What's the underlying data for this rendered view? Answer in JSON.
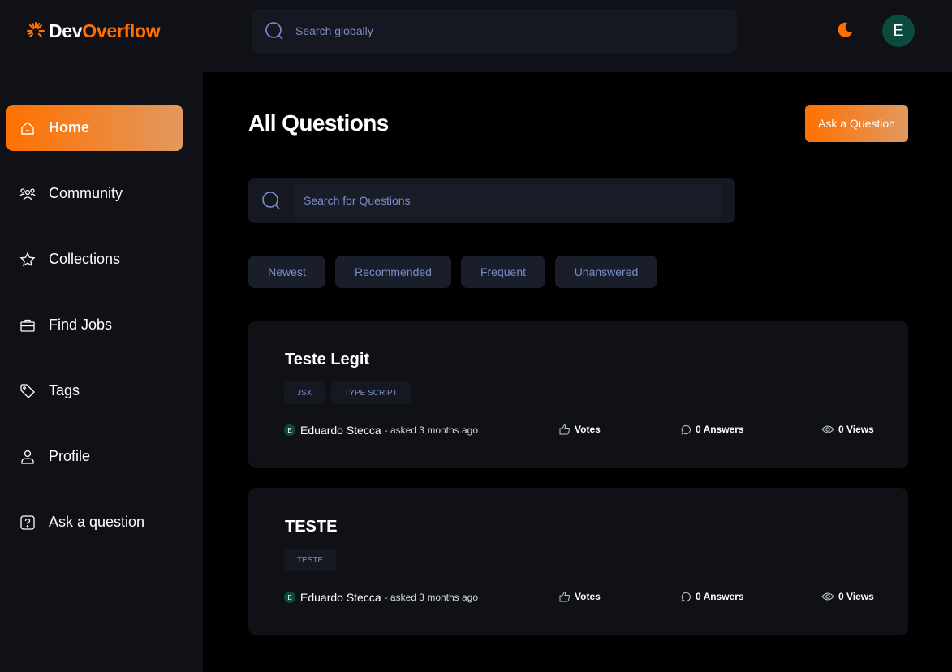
{
  "navbar": {
    "logo_prefix": "Dev",
    "logo_suffix": "Overflow",
    "search_placeholder": "Search globally",
    "avatar_initial": "E"
  },
  "sidebar": {
    "items": [
      {
        "label": "Home",
        "icon": "home-icon",
        "active": true
      },
      {
        "label": "Community",
        "icon": "users-icon"
      },
      {
        "label": "Collections",
        "icon": "star-icon"
      },
      {
        "label": "Find Jobs",
        "icon": "briefcase-icon"
      },
      {
        "label": "Tags",
        "icon": "tag-icon"
      },
      {
        "label": "Profile",
        "icon": "user-icon"
      },
      {
        "label": "Ask a question",
        "icon": "question-icon"
      }
    ]
  },
  "main": {
    "title": "All Questions",
    "ask_button": "Ask a Question",
    "search_placeholder": "Search for Questions",
    "filters": [
      "Newest",
      "Recommended",
      "Frequent",
      "Unanswered"
    ],
    "questions": [
      {
        "title": "Teste Legit",
        "tags": [
          "JSX",
          "TYPE SCRIPT"
        ],
        "author_initial": "E",
        "author": "Eduardo Stecca",
        "asked": "- asked 3 months ago",
        "votes": "Votes",
        "answers": "0 Answers",
        "views": "0 Views"
      },
      {
        "title": "TESTE",
        "tags": [
          "TESTE"
        ],
        "author_initial": "E",
        "author": "Eduardo Stecca",
        "asked": "- asked 3 months ago",
        "votes": "Votes",
        "answers": "0 Answers",
        "views": "0 Views"
      }
    ]
  },
  "colors": {
    "accent": "#ff7000",
    "accent_end": "#e2995f",
    "panel": "#0f1117",
    "input_bg": "#151821",
    "muted_text": "#7b8ec8",
    "avatar_bg": "#0b4a3c"
  }
}
